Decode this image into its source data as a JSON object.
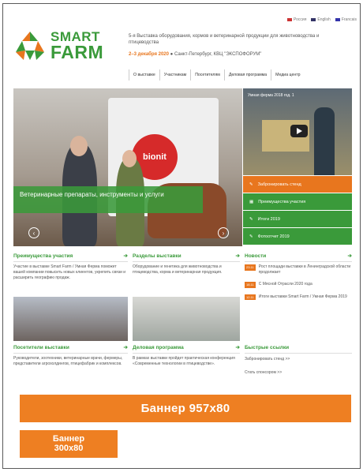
{
  "languages": [
    {
      "label": "Россия",
      "flag": "#c33"
    },
    {
      "label": "English",
      "flag": "#336"
    },
    {
      "label": "Francais",
      "flag": "#33a"
    }
  ],
  "logo": {
    "line1": "SMART",
    "line2": "FARM"
  },
  "header": {
    "tagline": "5-я Выставка оборудования, кормов и ветеринарной продукции для животноводства и птицеводства",
    "dates": "2–3 декабря 2020",
    "location": "● Санкт-Петербург, КВЦ \"ЭКСПОФОРУМ\""
  },
  "nav": [
    "О выставке",
    "Участникам",
    "Посетителям",
    "Деловая программа",
    "Медиа центр"
  ],
  "hero": {
    "booth_logo": "bionit",
    "caption": "Ветеринарные препараты, инструменты и услуги"
  },
  "video": {
    "title": "Умная ферма 2018 год. 1"
  },
  "side_buttons": [
    {
      "label": "Забронировать стенд",
      "icon": "pencil-icon",
      "color": "orange"
    },
    {
      "label": "Преимущества участия",
      "icon": "grid-icon",
      "color": "green"
    },
    {
      "label": "Итоги 2019",
      "icon": "pencil-icon",
      "color": "green"
    },
    {
      "label": "Фотоотчет 2019",
      "icon": "pencil-icon",
      "color": "green"
    }
  ],
  "blocks": {
    "advantages": {
      "title": "Преимущества участия",
      "text": "Участие в выставке Smart Farm / Умная Ферма поможет вашей компании повысить новых клиентов, укрепить связи и расширить географию продаж."
    },
    "sections": {
      "title": "Разделы выставки",
      "text": "Оборудование и генетика для животноводства и птицеводства, корма и ветеринарная продукция."
    },
    "news": {
      "title": "Новости",
      "items": [
        {
          "date": "23.11",
          "text": "Рост площади выставки в Ленинградской области продолжает"
        },
        {
          "date": "18.11",
          "text": "С Мясной Отрасли 2020 года"
        },
        {
          "date": "12.11",
          "text": "Итоги выставки Smart Farm / Умная Ферма 2019"
        }
      ]
    },
    "visitors": {
      "title": "Посетители выставки",
      "text": "Руководители, зоотехники, ветеринарные врачи, фермеры, представители агрохолдингов, птицефабрик и комплексов."
    },
    "business": {
      "title": "Деловая программа",
      "text": "В рамках выставки пройдет практическая конференция «Современные технологии в птицеводстве»."
    },
    "links": {
      "title": "Быстрые ссылки",
      "items": [
        "Забронировать стенд >>",
        "Стать спонсором >>"
      ]
    }
  },
  "banners": {
    "big": "Баннер 957х80",
    "small_line1": "Баннер",
    "small_line2": "300х80"
  }
}
